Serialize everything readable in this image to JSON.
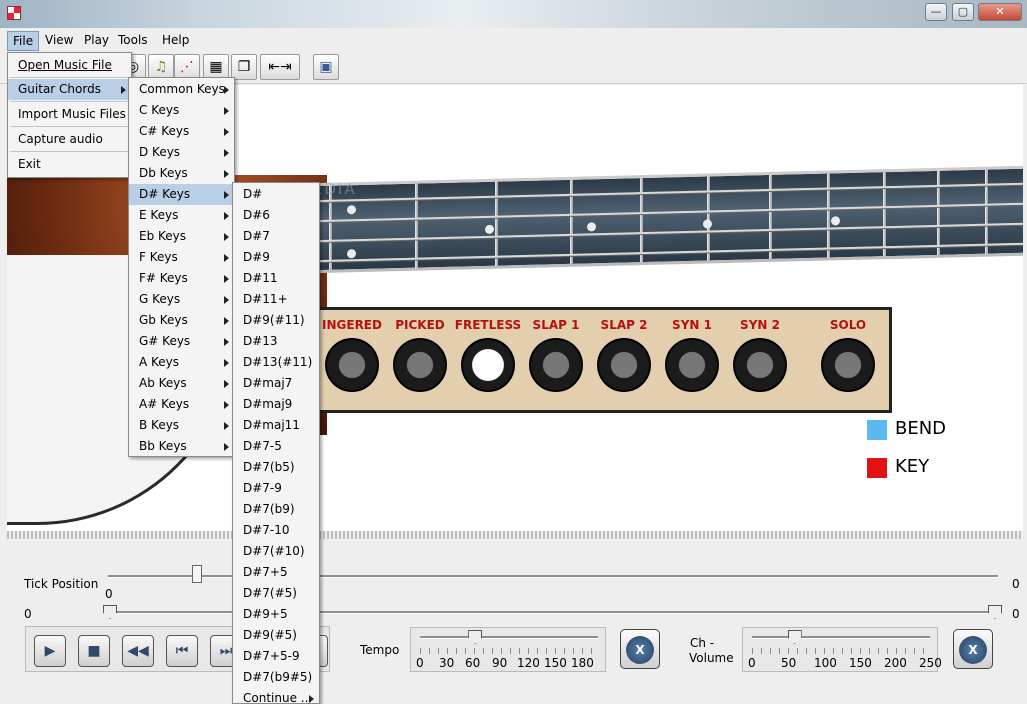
{
  "window": {
    "min_glyph": "—",
    "max_glyph": "▢",
    "close_glyph": "✕"
  },
  "menubar": [
    "File",
    "View",
    "Play",
    "Tools",
    "Help"
  ],
  "file_menu": {
    "items": [
      "Open Music File",
      "Guitar Chords",
      "Import Music Files",
      "Capture audio",
      "Exit"
    ],
    "selected": "Guitar Chords"
  },
  "keys_menu": {
    "items": [
      "Common Keys",
      "C Keys",
      "C# Keys",
      "D Keys",
      "Db Keys",
      "D# Keys",
      "E Keys",
      "Eb Keys",
      "F Keys",
      "F# Keys",
      "G Keys",
      "Gb Keys",
      "G# Keys",
      "A Keys",
      "Ab Keys",
      "A# Keys",
      "B Keys",
      "Bb Keys"
    ],
    "selected": "D# Keys"
  },
  "chords_menu": {
    "items": [
      "D#",
      "D#6",
      "D#7",
      "D#9",
      "D#11",
      "D#11+",
      "D#9(#11)",
      "D#13",
      "D#13(#11)",
      "D#maj7",
      "D#maj9",
      "D#maj11",
      "D#7-5",
      "D#7(b5)",
      "D#7-9",
      "D#7(b9)",
      "D#7-10",
      "D#7(#10)",
      "D#7+5",
      "D#7(#5)",
      "D#9+5",
      "D#9(#5)",
      "D#7+5-9",
      "D#7(b9#5)"
    ],
    "continue_label": "Continue ..."
  },
  "toolbar_icons": [
    "info-icon",
    "music-note-icon",
    "chord-pattern-icon",
    "grid-icon",
    "copy-icon",
    "timeline-icon",
    "window-icon"
  ],
  "watermark": "SOFTPEDIA",
  "amp": {
    "labels": [
      "INGERED",
      "PICKED",
      "FRETLESS",
      "SLAP 1",
      "SLAP 2",
      "SYN 1",
      "SYN 2",
      "SOLO"
    ],
    "active_index": 2
  },
  "legend": [
    {
      "label": "BEND",
      "color": "#5ab9ef"
    },
    {
      "label": "KEY",
      "color": "#e21212"
    }
  ],
  "tick_position": {
    "label": "Tick Position",
    "value": "0",
    "max": "0",
    "fraction": 0.1
  },
  "range_slider": {
    "min": "0",
    "max": "0"
  },
  "transport": [
    "play",
    "stop",
    "rewind",
    "skip-back",
    "skip-forward"
  ],
  "tempo": {
    "label": "Tempo",
    "scale": [
      "0",
      "30",
      "60",
      "90",
      "120",
      "150",
      "180"
    ],
    "fraction": 0.31
  },
  "volume": {
    "label_line1": "Ch -",
    "label_line2": "Volume",
    "scale": [
      "0",
      "50",
      "100",
      "150",
      "200",
      "250"
    ],
    "fraction": 0.24
  },
  "x_label": "X"
}
